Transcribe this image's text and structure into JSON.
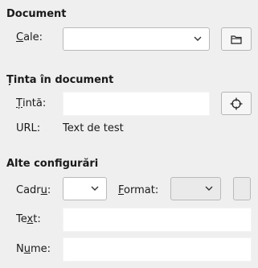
{
  "document": {
    "section_title": "Document",
    "path_label_mnemonic": "C",
    "path_label_rest": "ale:",
    "path_value": "",
    "browse_icon": "folder-icon"
  },
  "target": {
    "section_title": "Ținta în document",
    "target_label_mnemonic": "Ț",
    "target_label_rest": "intă:",
    "target_value": "",
    "target_icon": "crosshair-icon",
    "url_label": "URL:",
    "url_value": "Text de test"
  },
  "other": {
    "section_title": "Alte configurări",
    "frame_label_pre": "Cadr",
    "frame_label_mnemonic": "u",
    "frame_label_post": ":",
    "frame_value": "",
    "format_label_mnemonic": "F",
    "format_label_rest": "ormat:",
    "format_value": "",
    "text_label_pre": "Te",
    "text_label_mnemonic": "x",
    "text_label_post": "t:",
    "text_value": "",
    "name_label_pre": "N",
    "name_label_mnemonic": "u",
    "name_label_post": "me:",
    "name_value": ""
  }
}
